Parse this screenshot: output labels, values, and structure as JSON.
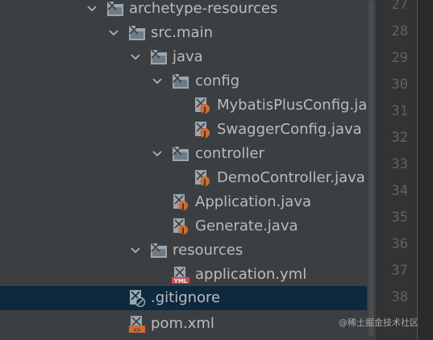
{
  "project_tree": {
    "nodes": [
      {
        "label": "archetype-resources",
        "kind": "folder",
        "expanded": true
      },
      {
        "label": "src.main",
        "kind": "folder",
        "expanded": true
      },
      {
        "label": "java",
        "kind": "folder",
        "expanded": true
      },
      {
        "label": "config",
        "kind": "folder",
        "expanded": true
      },
      {
        "label": "MybatisPlusConfig.java",
        "kind": "java-file"
      },
      {
        "label": "SwaggerConfig.java",
        "kind": "java-file"
      },
      {
        "label": "controller",
        "kind": "folder",
        "expanded": true
      },
      {
        "label": "DemoController.java",
        "kind": "java-file"
      },
      {
        "label": "Application.java",
        "kind": "java-file"
      },
      {
        "label": "Generate.java",
        "kind": "java-file"
      },
      {
        "label": "resources",
        "kind": "folder",
        "expanded": true
      },
      {
        "label": "application.yml",
        "kind": "yml-file"
      },
      {
        "label": ".gitignore",
        "kind": "ignore-file",
        "selected": true
      },
      {
        "label": "pom.xml",
        "kind": "maven-file"
      }
    ]
  },
  "gutter": {
    "line_numbers": [
      "27",
      "28",
      "29",
      "30",
      "31",
      "32",
      "33",
      "34",
      "35",
      "36",
      "37",
      "38"
    ]
  },
  "watermark": "@稀土掘金技术社区",
  "colors": {
    "tree_background": "#3c3f41",
    "selection": "#0d293e",
    "text": "#bbbbbb",
    "gutter_background": "#313335",
    "line_number": "#606366",
    "java_badge": "#d06b36",
    "yml_badge": "#c94f4f"
  },
  "icons": {
    "chevron": "chevron-down-icon",
    "folder": "folder-icon",
    "java": "java-file-icon",
    "yml": "yml-file-icon",
    "ignore": "gitignore-file-icon",
    "maven": "maven-pom-icon"
  }
}
